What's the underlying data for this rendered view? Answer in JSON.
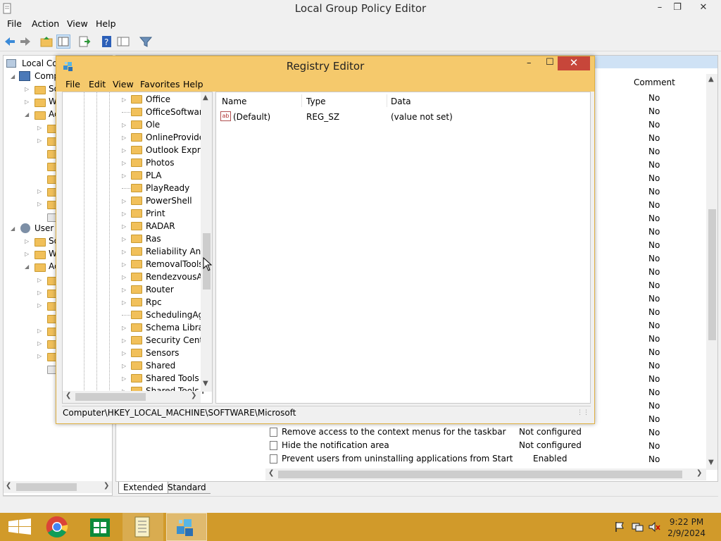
{
  "gpe": {
    "title": "Local Group Policy Editor",
    "menu": [
      "File",
      "Action",
      "View",
      "Help"
    ],
    "tree": {
      "local_computer": "Local Co",
      "computer_config": "Comp",
      "n1": "So",
      "n2": "W",
      "n3": "Ac",
      "user_config": "User C",
      "u1": "So",
      "u2": "W",
      "u3": "Ac"
    },
    "columns": {
      "comment": "Comment"
    },
    "comment_values": [
      "No",
      "No",
      "No",
      "No",
      "No",
      "No",
      "No",
      "No",
      "No",
      "No",
      "No",
      "No",
      "No",
      "No",
      "No",
      "No",
      "No",
      "No",
      "No",
      "No",
      "No",
      "No",
      "No",
      "No",
      "No",
      "No",
      "No",
      "No"
    ],
    "policies": [
      {
        "name": "Remove access to the context menus for the taskbar",
        "state": "Not configured"
      },
      {
        "name": "Hide the notification area",
        "state": "Not configured"
      },
      {
        "name": "Prevent users from uninstalling applications from Start",
        "state": "Enabled"
      }
    ],
    "tabs": {
      "extended": "Extended",
      "standard": "Standard"
    }
  },
  "reg": {
    "title": "Registry Editor",
    "menu": [
      "File",
      "Edit",
      "View",
      "Favorites",
      "Help"
    ],
    "tree": [
      "Office",
      "OfficeSoftware",
      "Ole",
      "OnlineProvide",
      "Outlook Expres",
      "Photos",
      "PLA",
      "PlayReady",
      "PowerShell",
      "Print",
      "RADAR",
      "Ras",
      "Reliability Ana",
      "RemovalTools",
      "RendezvousAp",
      "Router",
      "Rpc",
      "SchedulingAg",
      "Schema Librar",
      "Security Cente",
      "Sensors",
      "Shared",
      "Shared Tools",
      "Shared Tools I"
    ],
    "columns": {
      "name": "Name",
      "type": "Type",
      "data": "Data"
    },
    "values": [
      {
        "name": "(Default)",
        "type": "REG_SZ",
        "data": "(value not set)"
      }
    ],
    "status": "Computer\\HKEY_LOCAL_MACHINE\\SOFTWARE\\Microsoft"
  },
  "taskbar": {
    "time": "9:22 PM",
    "date": "2/9/2024"
  },
  "colors": {
    "taskbar": "#d19a2a",
    "reg_title": "#f5c96c",
    "close": "#c7463a",
    "folder": "#f1c05a"
  }
}
